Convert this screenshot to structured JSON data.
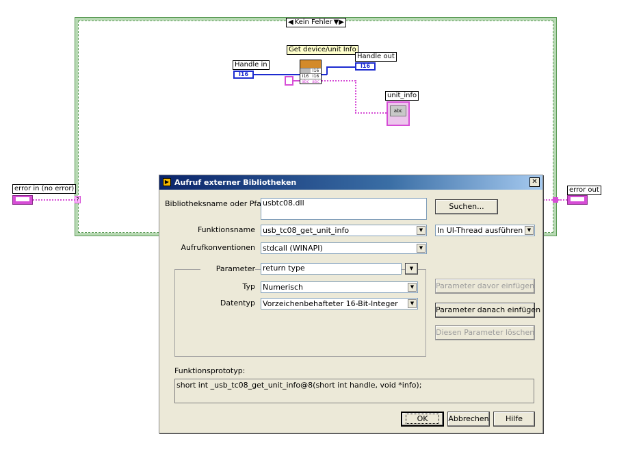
{
  "diagram": {
    "case_selector": "Kein Fehler",
    "label_get_device": "Get device/unit Info",
    "label_handle_in": "Handle in",
    "label_handle_out": "Handle out",
    "label_unit_info": "unit_info",
    "label_error_in": "error in (no error)",
    "label_error_out": "error out",
    "i16_text": "I16",
    "abc_text": "abc"
  },
  "dialog": {
    "title": "Aufruf externer Bibliotheken",
    "close_glyph": "✕",
    "lib_label": "Bibliotheksname oder Pfad",
    "lib_value": "usbtc08.dll",
    "search_button": "Suchen...",
    "func_label": "Funktionsname",
    "func_value": "usb_tc08_get_unit_info",
    "thread_value": "In UI-Thread ausführen",
    "conv_label": "Aufrufkonventionen",
    "conv_value": "stdcall (WINAPI)",
    "param_label": "Parameter",
    "param_value": "return type",
    "type_label": "Typ",
    "type_value": "Numerisch",
    "datatype_label": "Datentyp",
    "datatype_value": "Vorzeichenbehafteter 16-Bit-Integer",
    "btn_insert_before": "Parameter davor einfügen",
    "btn_insert_after": "Parameter danach einfügen",
    "btn_delete": "Diesen Parameter löschen",
    "proto_label": "Funktionsprototyp:",
    "proto_value": "short int _usb_tc08_get_unit_info@8(short int handle, void *info);",
    "ok": "OK",
    "cancel": "Abbrechen",
    "help": "Hilfe"
  }
}
